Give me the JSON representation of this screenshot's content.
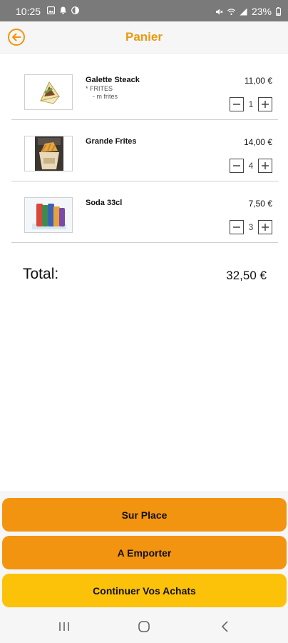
{
  "status_bar": {
    "time": "10:25",
    "left_icons": [
      "image-icon",
      "bell-icon",
      "moon-icon"
    ],
    "right_icons": [
      "mute-icon",
      "wifi-icon",
      "signal-icon"
    ],
    "battery": "23%"
  },
  "header": {
    "title": "Panier",
    "back_icon": "back-arrow-icon",
    "accent_color": "#e89a10"
  },
  "cart": {
    "items": [
      {
        "name": "Galette Steack",
        "options": [
          "* FRITES",
          "- m frites"
        ],
        "price": "11,00 €",
        "quantity": "1",
        "thumb_icon": "galette-wrap-image"
      },
      {
        "name": "Grande Frites",
        "options": [],
        "price": "14,00 €",
        "quantity": "4",
        "thumb_icon": "fries-image"
      },
      {
        "name": "Soda 33cl",
        "options": [],
        "price": "7,50 €",
        "quantity": "3",
        "thumb_icon": "soda-cans-image"
      }
    ]
  },
  "total": {
    "label": "Total:",
    "value": "32,50 €"
  },
  "actions": {
    "sur_place": "Sur Place",
    "a_emporter": "A Emporter",
    "continuer": "Continuer Vos Achats",
    "orange_color": "#f39410",
    "yellow_color": "#fcc20a"
  },
  "nav_bar": {
    "icons": [
      "recent-apps-icon",
      "home-icon",
      "back-icon"
    ]
  }
}
